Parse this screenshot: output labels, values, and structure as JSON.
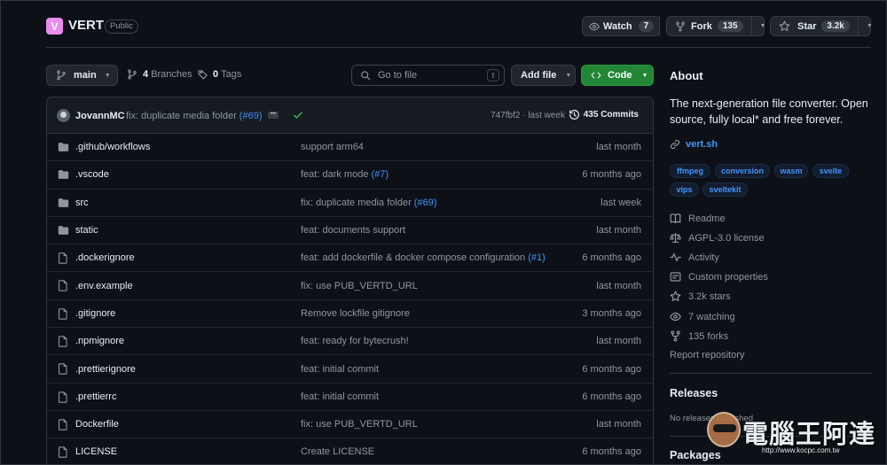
{
  "repo": {
    "name": "VERT",
    "visibility": "Public",
    "logo_letter": "V",
    "logo_color": "#e98cf0"
  },
  "header_actions": {
    "watch_label": "Watch",
    "watch_count": "7",
    "fork_label": "Fork",
    "fork_count": "135",
    "star_label": "Star",
    "star_count": "3.2k"
  },
  "toolbar": {
    "branch": "main",
    "branches_count": "4",
    "branches_label": "Branches",
    "tags_count": "0",
    "tags_label": "Tags",
    "goto_placeholder": "Go to file",
    "goto_shortcut": "t",
    "add_file_label": "Add file",
    "code_label": "Code"
  },
  "latest_commit": {
    "author": "JovannMC",
    "message": "fix: duplicate media folder",
    "pr_ref": "(#69)",
    "hash_time": "747fbf2 · last week",
    "commits_count": "435 Commits"
  },
  "files": [
    {
      "type": "dir",
      "name": ".github/workflows",
      "msg": "support arm64",
      "ref": "",
      "time": "last month"
    },
    {
      "type": "dir",
      "name": ".vscode",
      "msg": "feat: dark mode",
      "ref": "(#7)",
      "time": "6 months ago"
    },
    {
      "type": "dir",
      "name": "src",
      "msg": "fix: duplicate media folder",
      "ref": "(#69)",
      "time": "last week"
    },
    {
      "type": "dir",
      "name": "static",
      "msg": "feat: documents support",
      "ref": "",
      "time": "last month"
    },
    {
      "type": "file",
      "name": ".dockerignore",
      "msg": "feat: add dockerfile & docker compose configuration",
      "ref": "(#1)",
      "time": "6 months ago"
    },
    {
      "type": "file",
      "name": ".env.example",
      "msg": "fix: use PUB_VERTD_URL",
      "ref": "",
      "time": "last month"
    },
    {
      "type": "file",
      "name": ".gitignore",
      "msg": "Remove lockfile gitignore",
      "ref": "",
      "time": "3 months ago"
    },
    {
      "type": "file",
      "name": ".npmignore",
      "msg": "feat: ready for bytecrush!",
      "ref": "",
      "time": "last month"
    },
    {
      "type": "file",
      "name": ".prettierignore",
      "msg": "feat: initial commit",
      "ref": "",
      "time": "6 months ago"
    },
    {
      "type": "file",
      "name": ".prettierrc",
      "msg": "feat: initial commit",
      "ref": "",
      "time": "6 months ago"
    },
    {
      "type": "file",
      "name": "Dockerfile",
      "msg": "fix: use PUB_VERTD_URL",
      "ref": "",
      "time": "last month"
    },
    {
      "type": "file",
      "name": "LICENSE",
      "msg": "Create LICENSE",
      "ref": "",
      "time": "6 months ago"
    }
  ],
  "about": {
    "heading": "About",
    "description": "The next-generation file converter. Open source, fully local* and free forever.",
    "website": "vert.sh",
    "topics": [
      "ffmpeg",
      "conversion",
      "wasm",
      "svelte",
      "vips",
      "sveltekit"
    ],
    "readme": "Readme",
    "license": "AGPL-3.0 license",
    "activity": "Activity",
    "custom_props": "Custom properties",
    "stars": "3.2k stars",
    "watching": "7 watching",
    "forks": "135 forks",
    "report": "Report repository"
  },
  "releases": {
    "heading": "Releases",
    "empty": "No releases published"
  },
  "packages": {
    "heading": "Packages"
  },
  "watermark": {
    "text": "電腦王阿達",
    "url": "http://www.kocpc.com.tw"
  }
}
